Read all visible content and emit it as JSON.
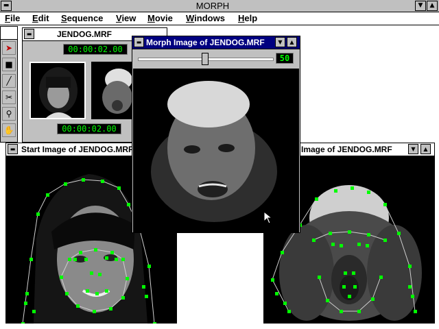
{
  "app": {
    "title": "MORPH"
  },
  "menu": [
    "File",
    "Edit",
    "Sequence",
    "View",
    "Movie",
    "Windows",
    "Help"
  ],
  "tools": [
    "arrow-tool",
    "point-tool",
    "line-tool",
    "scissors-tool",
    "zoom-tool",
    "hand-tool"
  ],
  "movie_window": {
    "title": "JENDOG.MRF",
    "timecode_top": "00:00:02.00",
    "timecode_bottom": "00:00:02.00"
  },
  "morph_window": {
    "title": "Morph Image of JENDOG.MRF",
    "slider_value": "50",
    "slider_fraction": 0.5
  },
  "start_window": {
    "title": "Start Image of JENDOG.MRF"
  },
  "end_window": {
    "title": "Image of JENDOG.MRF"
  },
  "colors": {
    "lcd_green": "#00ff00",
    "control_point": "#00ff00",
    "active_title": "#000080"
  }
}
